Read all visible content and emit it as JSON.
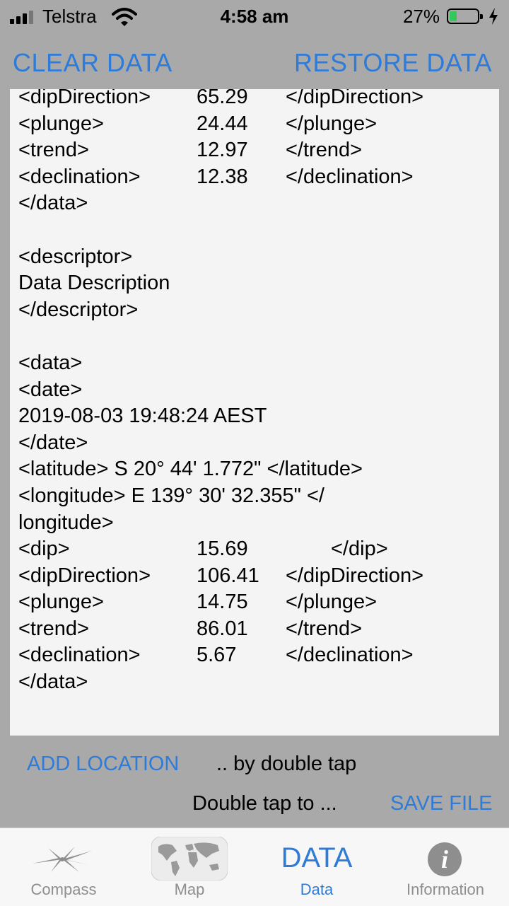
{
  "status_bar": {
    "carrier": "Telstra",
    "time": "4:58 am",
    "battery_percent": "27%",
    "battery_level": 0.27
  },
  "toolbar": {
    "clear_label": "CLEAR DATA",
    "restore_label": "RESTORE DATA"
  },
  "text": {
    "l1": {
      "a": "<dipDirection>",
      "b": "65.29",
      "c": "</dipDirection>"
    },
    "l2": {
      "a": "<plunge>",
      "b": "24.44",
      "c": "</plunge>"
    },
    "l3": {
      "a": "<trend>",
      "b": "12.97",
      "c": "</trend>"
    },
    "l4": {
      "a": "<declination>",
      "b": "12.38",
      "c": "</declination>"
    },
    "l5": "</data>",
    "l7": "<descriptor>",
    "l8": "Data Description",
    "l9": "</descriptor>",
    "l11": "<data>",
    "l12": "<date>",
    "l13": "2019-08-03 19:48:24 AEST",
    "l14": "</date>",
    "l15": "<latitude> S 20°  44'  1.772\"  </latitude>",
    "l16": "<longitude> E 139°  30'  32.355\"  </",
    "l17": "longitude>",
    "l18": {
      "a": "<dip>",
      "b": "15.69",
      "c": "</dip>"
    },
    "l19": {
      "a": "<dipDirection>",
      "b": "106.41",
      "c": "</dipDirection>"
    },
    "l20": {
      "a": "<plunge>",
      "b": "14.75",
      "c": "</plunge>"
    },
    "l21": {
      "a": "<trend>",
      "b": "86.01",
      "c": "</trend>"
    },
    "l22": {
      "a": "<declination>",
      "b": "5.67",
      "c": "</declination>"
    },
    "l23": "</data>"
  },
  "bottom": {
    "add_location_label": "ADD LOCATION",
    "hint_double_tap": ".. by double tap",
    "hint_double_tap_to": "Double tap to ...",
    "save_label": "SAVE FILE"
  },
  "tabs": [
    {
      "label": "Compass",
      "icon": "compass-star-icon"
    },
    {
      "label": "Map",
      "icon": "world-map-icon"
    },
    {
      "label": "Data",
      "word": "DATA"
    },
    {
      "label": "Information",
      "icon": "info-icon"
    }
  ],
  "colors": {
    "accent": "#2e7bd8",
    "background": "#a9a9a9",
    "panel": "#f4f4f4",
    "tab_inactive": "#8e8e8e"
  }
}
